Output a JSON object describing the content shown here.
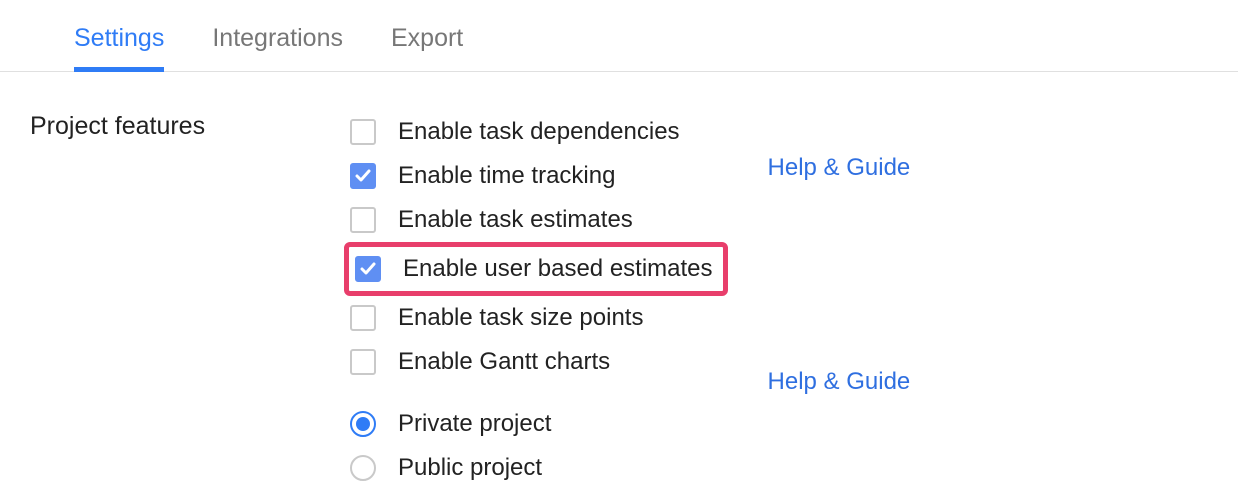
{
  "tabs": {
    "settings": "Settings",
    "integrations": "Integrations",
    "export": "Export"
  },
  "section_title": "Project features",
  "features": {
    "dependencies": {
      "label": "Enable task dependencies",
      "checked": false
    },
    "time_tracking": {
      "label": "Enable time tracking",
      "checked": true
    },
    "task_estimates": {
      "label": "Enable task estimates",
      "checked": false
    },
    "user_estimates": {
      "label": "Enable user based estimates",
      "checked": true,
      "highlighted": true
    },
    "size_points": {
      "label": "Enable task size points",
      "checked": false
    },
    "gantt": {
      "label": "Enable Gantt charts",
      "checked": false
    }
  },
  "visibility": {
    "private": {
      "label": "Private project",
      "selected": true
    },
    "public": {
      "label": "Public project",
      "selected": false
    }
  },
  "help": {
    "dependencies": "Help & Guide",
    "gantt": "Help & Guide"
  }
}
